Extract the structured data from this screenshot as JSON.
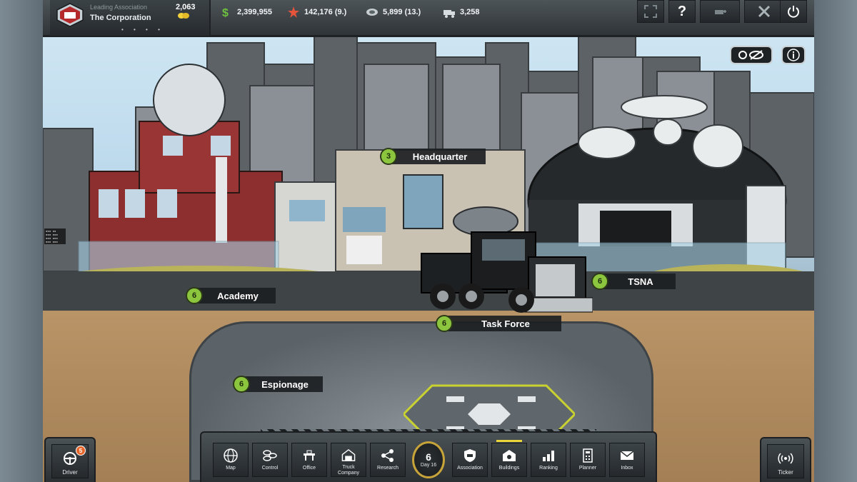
{
  "association": {
    "subtitle": "Leading Association",
    "name": "The Corporation",
    "pager": "• • • •"
  },
  "resources": {
    "gold": "2,063",
    "cash": "2,399,955",
    "prestige": "142,176 (9.)",
    "reputation": "5,899 (13.)",
    "trucks": "3,258"
  },
  "top_buttons": [
    "fullscreen-icon",
    "help-icon",
    "truck-add-icon",
    "tools-icon",
    "power-icon"
  ],
  "top_button_help_label": "?",
  "buildings": [
    {
      "name": "Headquarter",
      "level": "3"
    },
    {
      "name": "Academy",
      "level": "6"
    },
    {
      "name": "TSNA",
      "level": "6"
    },
    {
      "name": "Task Force",
      "level": "6"
    },
    {
      "name": "Espionage",
      "level": "6"
    }
  ],
  "nav": [
    {
      "label": "Map",
      "icon": "globe-icon"
    },
    {
      "label": "Control",
      "icon": "control-icon"
    },
    {
      "label": "Office",
      "icon": "office-icon"
    },
    {
      "label": "Truck Company",
      "icon": "garage-icon"
    },
    {
      "label": "Research",
      "icon": "research-icon"
    },
    {
      "label": "Association",
      "icon": "shield-icon"
    },
    {
      "label": "Buildings",
      "icon": "buildings-icon",
      "active": true
    },
    {
      "label": "Ranking",
      "icon": "ranking-icon"
    },
    {
      "label": "Planner",
      "icon": "planner-icon"
    },
    {
      "label": "Inbox",
      "icon": "mail-icon"
    }
  ],
  "day": {
    "number": "6",
    "label": "Day 16"
  },
  "driver": {
    "label": "Driver",
    "badge": "5"
  },
  "ticker": {
    "label": "Ticker"
  },
  "colors": {
    "level_badge": "#8cc63f",
    "active_tab": "#e9d43a",
    "hud_dark": "#2b3033"
  }
}
